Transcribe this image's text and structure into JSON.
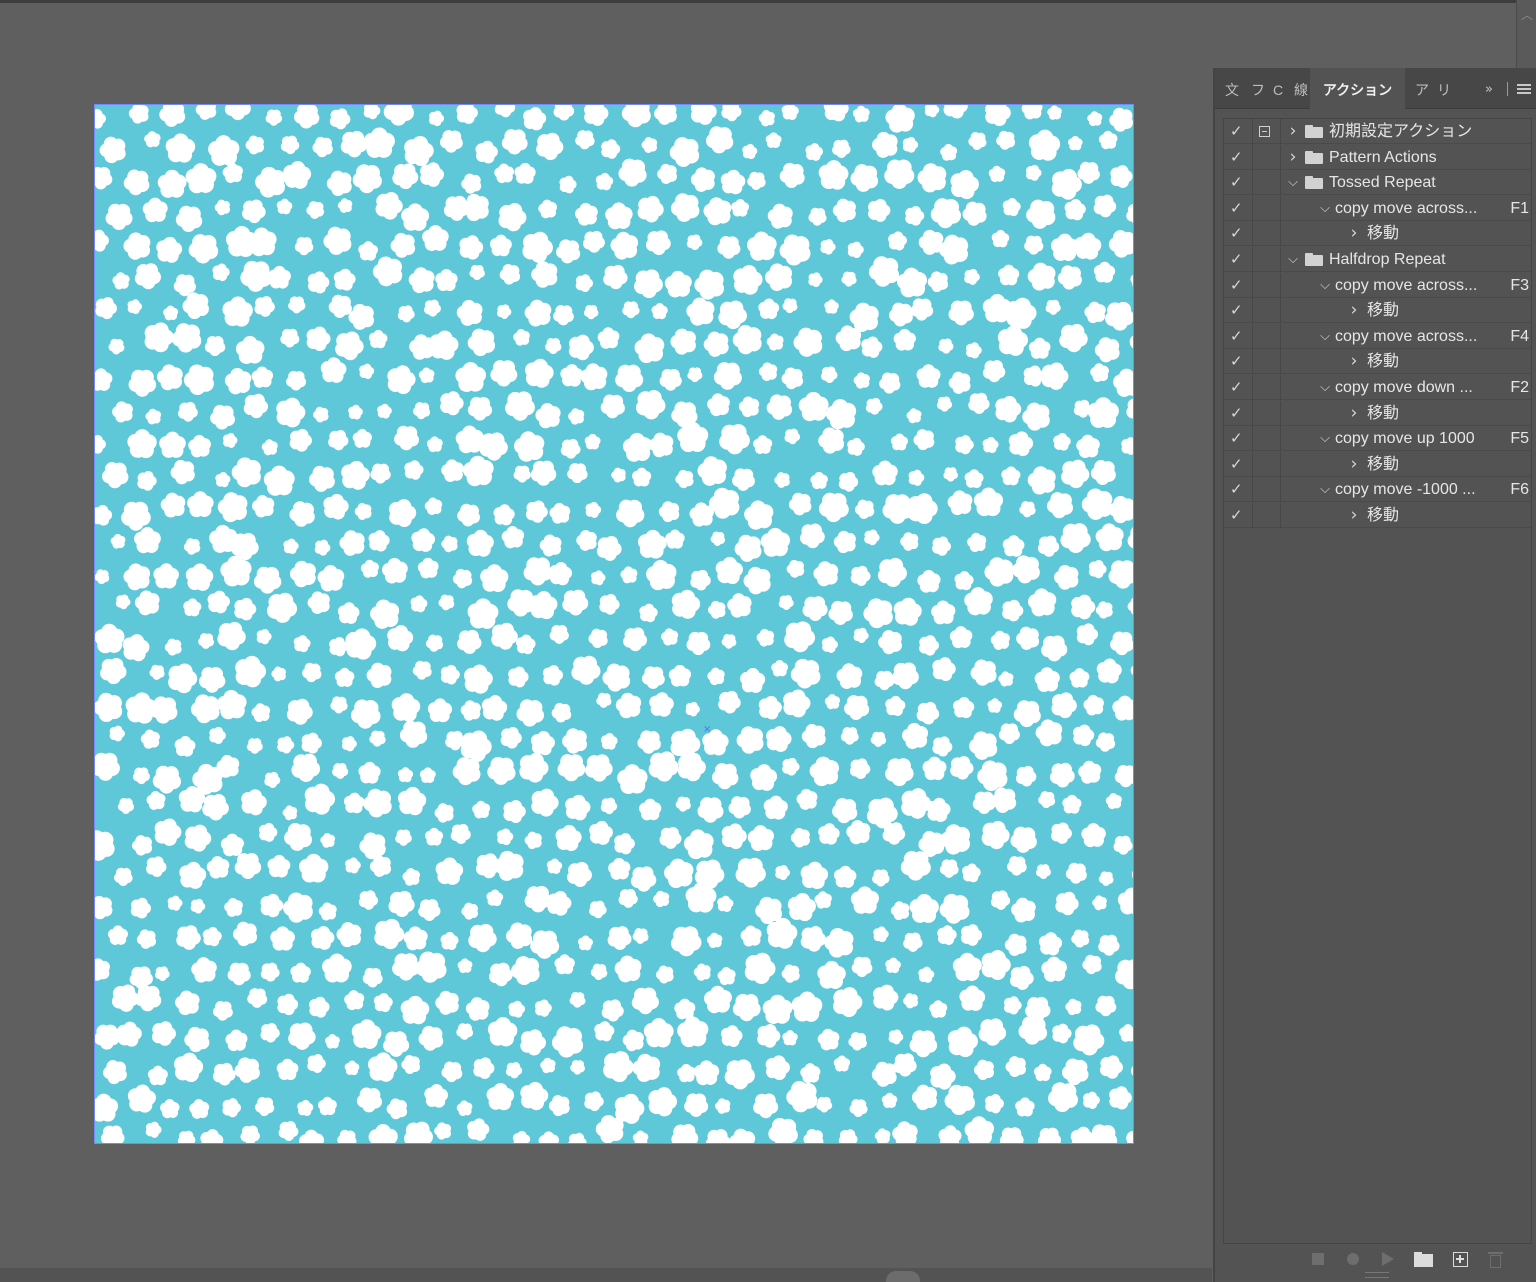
{
  "panel": {
    "tabs": [
      {
        "label": "文",
        "active": false
      },
      {
        "label": "フ",
        "active": false
      },
      {
        "label": "C",
        "active": false
      },
      {
        "label": "線",
        "active": false
      },
      {
        "label": "アクション",
        "active": true
      },
      {
        "label": "ア",
        "active": false
      },
      {
        "label": "リ",
        "active": false
      }
    ],
    "expand_label": "»",
    "actions": [
      {
        "label": "初期設定アクション",
        "type": "set",
        "expanded": false,
        "level": 0,
        "fkey": "",
        "checked": true,
        "dialog": true
      },
      {
        "label": "Pattern Actions",
        "type": "set",
        "expanded": false,
        "level": 0,
        "fkey": "",
        "checked": true,
        "dialog": false
      },
      {
        "label": "Tossed Repeat",
        "type": "set",
        "expanded": true,
        "level": 0,
        "fkey": "",
        "checked": true,
        "dialog": false
      },
      {
        "label": "copy move across...",
        "type": "action",
        "expanded": true,
        "level": 1,
        "fkey": "F1",
        "checked": true,
        "dialog": false
      },
      {
        "label": "移動",
        "type": "step",
        "expanded": false,
        "level": 2,
        "fkey": "",
        "checked": true,
        "dialog": false
      },
      {
        "label": "Halfdrop Repeat",
        "type": "set",
        "expanded": true,
        "level": 0,
        "fkey": "",
        "checked": true,
        "dialog": false
      },
      {
        "label": "copy move across...",
        "type": "action",
        "expanded": true,
        "level": 1,
        "fkey": "F3",
        "checked": true,
        "dialog": false
      },
      {
        "label": "移動",
        "type": "step",
        "expanded": false,
        "level": 2,
        "fkey": "",
        "checked": true,
        "dialog": false
      },
      {
        "label": "copy move across...",
        "type": "action",
        "expanded": true,
        "level": 1,
        "fkey": "F4",
        "checked": true,
        "dialog": false
      },
      {
        "label": "移動",
        "type": "step",
        "expanded": false,
        "level": 2,
        "fkey": "",
        "checked": true,
        "dialog": false
      },
      {
        "label": "copy move down ...",
        "type": "action",
        "expanded": true,
        "level": 1,
        "fkey": "F2",
        "checked": true,
        "dialog": false
      },
      {
        "label": "移動",
        "type": "step",
        "expanded": false,
        "level": 2,
        "fkey": "",
        "checked": true,
        "dialog": false
      },
      {
        "label": "copy move up 1000",
        "type": "action",
        "expanded": true,
        "level": 1,
        "fkey": "F5",
        "checked": true,
        "dialog": false
      },
      {
        "label": "移動",
        "type": "step",
        "expanded": false,
        "level": 2,
        "fkey": "",
        "checked": true,
        "dialog": false
      },
      {
        "label": "copy move -1000 ...",
        "type": "action",
        "expanded": true,
        "level": 1,
        "fkey": "F6",
        "checked": true,
        "dialog": false
      },
      {
        "label": "移動",
        "type": "step",
        "expanded": false,
        "level": 2,
        "fkey": "",
        "checked": true,
        "dialog": false
      }
    ],
    "footer_icons": [
      "stop-icon",
      "record-icon",
      "play-icon",
      "new-set-folder-icon",
      "new-action-icon",
      "delete-icon"
    ]
  },
  "artboard": {
    "background_color": "#5ec8d8",
    "motif_color": "#ffffff",
    "motif": "flower-icon"
  },
  "colors": {
    "workspace": "#5f5f5f",
    "panel": "#535353",
    "selection": "#6f8bff"
  }
}
